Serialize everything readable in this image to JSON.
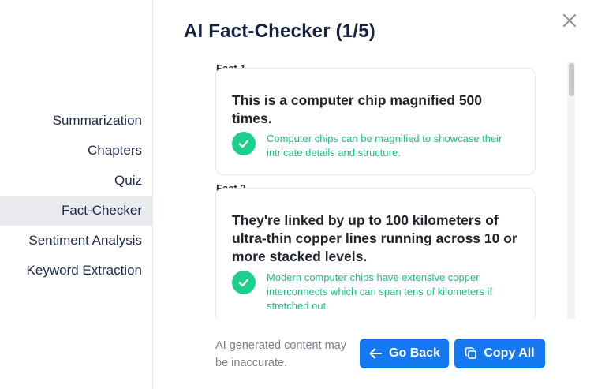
{
  "sidebar": {
    "items": [
      {
        "label": "Summarization",
        "active": false
      },
      {
        "label": "Chapters",
        "active": false
      },
      {
        "label": "Quiz",
        "active": false
      },
      {
        "label": "Fact-Checker",
        "active": true
      },
      {
        "label": "Sentiment Analysis",
        "active": false
      },
      {
        "label": "Keyword Extraction",
        "active": false
      }
    ]
  },
  "header": {
    "title": "AI Fact-Checker (1/5)",
    "close_icon": "close-icon"
  },
  "facts": [
    {
      "label": "Fact 1",
      "statement": "This is a computer chip magnified 500 times.",
      "verdict_icon": "check-icon",
      "note": "Computer chips can be magnified to showcase their intricate details and structure."
    },
    {
      "label": "Fact 2",
      "statement": "They're linked by up to 100 kilometers of ultra-thin copper lines running across 10 or more stacked levels.",
      "verdict_icon": "check-icon",
      "note": "Modern computer chips have extensive copper interconnects which can span tens of kilometers if stretched out."
    }
  ],
  "footer": {
    "disclaimer": "AI generated content may be inaccurate.",
    "back_label": "Go Back",
    "back_icon": "arrow-left-icon",
    "copy_label": "Copy All",
    "copy_icon": "copy-icon"
  },
  "colors": {
    "accent": "#1479f0",
    "success": "#1ccf8f",
    "success_text": "#18c08b",
    "title": "#15233f",
    "active_bg": "#e8eaee"
  }
}
